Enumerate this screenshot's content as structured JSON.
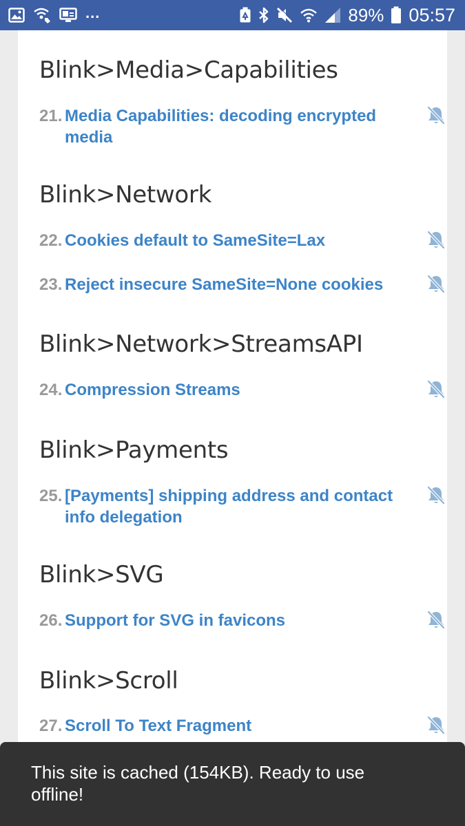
{
  "status_bar": {
    "overflow": "...",
    "battery_percent": "89%",
    "time": "05:57",
    "icons": [
      "image-icon",
      "wifi-calling-icon",
      "cast-icon",
      "battery-saver-icon",
      "bluetooth-icon",
      "mute-icon",
      "wifi-icon",
      "signal-icon",
      "battery-icon"
    ]
  },
  "sections": [
    {
      "title": "Blink>Media>Capabilities",
      "items": [
        {
          "number": "21.",
          "label": "Media Capabilities: decoding encrypted media",
          "icon": "bell-off-icon"
        }
      ]
    },
    {
      "title": "Blink>Network",
      "items": [
        {
          "number": "22.",
          "label": "Cookies default to SameSite=Lax",
          "icon": "bell-off-icon"
        },
        {
          "number": "23.",
          "label": "Reject insecure SameSite=None cookies",
          "icon": "bell-off-icon"
        }
      ]
    },
    {
      "title": "Blink>Network>StreamsAPI",
      "items": [
        {
          "number": "24.",
          "label": "Compression Streams",
          "icon": "bell-off-icon"
        }
      ]
    },
    {
      "title": "Blink>Payments",
      "items": [
        {
          "number": "25.",
          "label": "[Payments] shipping address and contact info delegation",
          "icon": "bell-off-icon"
        }
      ]
    },
    {
      "title": "Blink>SVG",
      "items": [
        {
          "number": "26.",
          "label": "Support for SVG in favicons",
          "icon": "bell-off-icon"
        }
      ]
    },
    {
      "title": "Blink>Scroll",
      "items": [
        {
          "number": "27.",
          "label": "Scroll To Text Fragment",
          "icon": "bell-off-icon"
        }
      ]
    }
  ],
  "snackbar": {
    "message": "This site is cached (154KB). Ready to use offline!"
  },
  "colors": {
    "status_bar": "#3c5fa5",
    "link": "#3d84c7",
    "number": "#999999",
    "heading": "#333333",
    "bell": "#8fb4d6",
    "snackbar": "#323232"
  }
}
